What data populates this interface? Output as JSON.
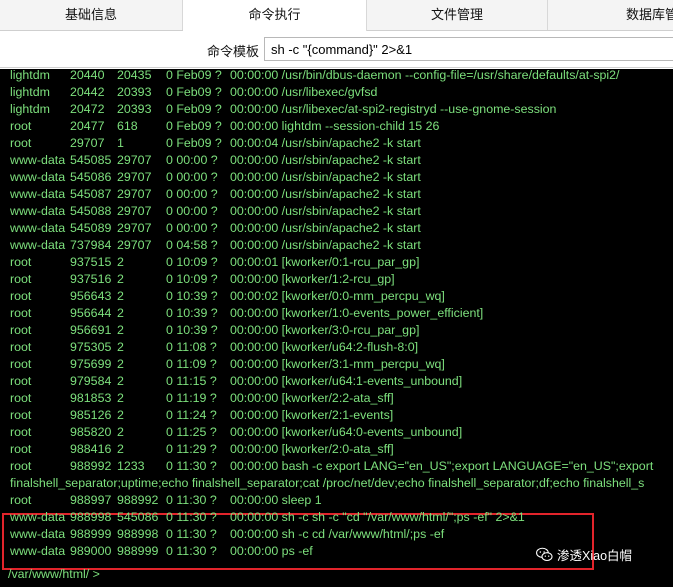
{
  "tabs": [
    "基础信息",
    "命令执行",
    "文件管理",
    "数据库管"
  ],
  "command_bar": {
    "label": "命令模板",
    "template": "sh -c \"{command}\" 2>&1"
  },
  "process_rows": [
    [
      "lightdm",
      "20440",
      "20435",
      "0 Feb09 ?",
      "00:00:00 /usr/bin/dbus-daemon --config-file=/usr/share/defaults/at-spi2/"
    ],
    [
      "lightdm",
      "20442",
      "20393",
      "0 Feb09 ?",
      "00:00:00 /usr/libexec/gvfsd"
    ],
    [
      "lightdm",
      "20472",
      "20393",
      "0 Feb09 ?",
      "00:00:00 /usr/libexec/at-spi2-registryd --use-gnome-session"
    ],
    [
      "root",
      "20477",
      "618",
      "0 Feb09 ?",
      "00:00:00 lightdm --session-child 15 26"
    ],
    [
      "root",
      "29707",
      "1",
      "0 Feb09 ?",
      "00:00:04 /usr/sbin/apache2 -k start"
    ],
    [
      "www-data",
      "545085",
      "29707",
      "0 00:00 ?",
      "00:00:00 /usr/sbin/apache2 -k start"
    ],
    [
      "www-data",
      "545086",
      "29707",
      "0 00:00 ?",
      "00:00:00 /usr/sbin/apache2 -k start"
    ],
    [
      "www-data",
      "545087",
      "29707",
      "0 00:00 ?",
      "00:00:00 /usr/sbin/apache2 -k start"
    ],
    [
      "www-data",
      "545088",
      "29707",
      "0 00:00 ?",
      "00:00:00 /usr/sbin/apache2 -k start"
    ],
    [
      "www-data",
      "545089",
      "29707",
      "0 00:00 ?",
      "00:00:00 /usr/sbin/apache2 -k start"
    ],
    [
      "www-data",
      "737984",
      "29707",
      "0 04:58 ?",
      "00:00:00 /usr/sbin/apache2 -k start"
    ],
    [
      "root",
      "937515",
      "2",
      "0 10:09 ?",
      "00:00:01 [kworker/0:1-rcu_par_gp]"
    ],
    [
      "root",
      "937516",
      "2",
      "0 10:09 ?",
      "00:00:00 [kworker/1:2-rcu_gp]"
    ],
    [
      "root",
      "956643",
      "2",
      "0 10:39 ?",
      "00:00:02 [kworker/0:0-mm_percpu_wq]"
    ],
    [
      "root",
      "956644",
      "2",
      "0 10:39 ?",
      "00:00:00 [kworker/1:0-events_power_efficient]"
    ],
    [
      "root",
      "956691",
      "2",
      "0 10:39 ?",
      "00:00:00 [kworker/3:0-rcu_par_gp]"
    ],
    [
      "root",
      "975305",
      "2",
      "0 11:08 ?",
      "00:00:00 [kworker/u64:2-flush-8:0]"
    ],
    [
      "root",
      "975699",
      "2",
      "0 11:09 ?",
      "00:00:00 [kworker/3:1-mm_percpu_wq]"
    ],
    [
      "root",
      "979584",
      "2",
      "0 11:15 ?",
      "00:00:00 [kworker/u64:1-events_unbound]"
    ],
    [
      "root",
      "981853",
      "2",
      "0 11:19 ?",
      "00:00:00 [kworker/2:2-ata_sff]"
    ],
    [
      "root",
      "985126",
      "2",
      "0 11:24 ?",
      "00:00:00 [kworker/2:1-events]"
    ],
    [
      "root",
      "985820",
      "2",
      "0 11:25 ?",
      "00:00:00 [kworker/u64:0-events_unbound]"
    ],
    [
      "root",
      "988416",
      "2",
      "0 11:29 ?",
      "00:00:00 [kworker/2:0-ata_sff]"
    ],
    [
      "root",
      "988992",
      "1233",
      "0 11:30 ?",
      "00:00:00 bash -c export LANG=\"en_US\";export LANGUAGE=\"en_US\";export"
    ]
  ],
  "wrapped_line": "finalshell_separator;uptime;echo finalshell_separator;cat /proc/net/dev;echo finalshell_separator;df;echo finalshell_s",
  "row_sleep": [
    "root",
    "988997",
    "988992",
    "0 11:30 ?",
    "00:00:00 sleep 1"
  ],
  "highlighted_rows": [
    [
      "www-data",
      "988998",
      "545086",
      "0 11:30 ?",
      "00:00:00 sh -c sh -c \"cd \"/var/www/html/\";ps -ef\" 2>&1"
    ],
    [
      "www-data",
      "988999",
      "988998",
      "0 11:30 ?",
      "00:00:00 sh -c cd /var/www/html/;ps -ef"
    ],
    [
      "www-data",
      "989000",
      "988999",
      "0 11:30 ?",
      "00:00:00 ps -ef"
    ]
  ],
  "prompt": "/var/www/html/ >",
  "watermark": {
    "text": "渗透Xiao白帽",
    "icon": "wechat-icon"
  },
  "colors": {
    "terminal_bg": "#000000",
    "terminal_text": "#7de07d",
    "highlight_border": "#e2242b"
  }
}
